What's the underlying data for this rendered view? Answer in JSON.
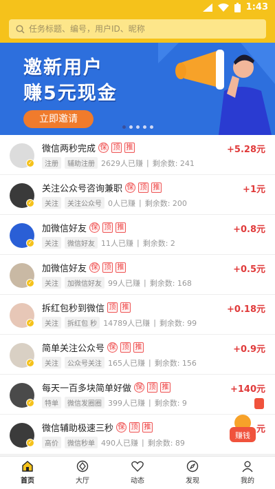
{
  "status_bar": {
    "time": "1:43"
  },
  "search": {
    "placeholder": "任务标题、编号，用户ID、昵称"
  },
  "banner": {
    "line1": "邀新用户",
    "line2": "赚5元现金",
    "button": "立即邀请"
  },
  "tasks": [
    {
      "title": "微信两秒完成",
      "tags": [
        "保",
        "顶",
        "推"
      ],
      "chips": [
        "注册",
        "辅助注册"
      ],
      "earned": "2629人已赚",
      "remaining": "剩余数: 241",
      "reward": "+5.28元"
    },
    {
      "title": "关注公众号咨询兼职",
      "tags": [
        "保",
        "顶",
        "推"
      ],
      "chips": [
        "关注",
        "关注公众号"
      ],
      "earned": "0人已赚",
      "remaining": "剩余数: 200",
      "reward": "+1元"
    },
    {
      "title": "加微信好友",
      "tags": [
        "保",
        "顶",
        "推"
      ],
      "chips": [
        "关注",
        "微信好友"
      ],
      "earned": "11人已赚",
      "remaining": "剩余数: 2",
      "reward": "+0.8元"
    },
    {
      "title": "加微信好友",
      "tags": [
        "保",
        "顶",
        "推"
      ],
      "chips": [
        "关注",
        "加微信好友"
      ],
      "earned": "99人已赚",
      "remaining": "剩余数: 168",
      "reward": "+0.5元"
    },
    {
      "title": "拆红包秒到微信",
      "tags": [
        "顶",
        "推"
      ],
      "chips": [
        "关注",
        "拆红包 秒"
      ],
      "earned": "14789人已赚",
      "remaining": "剩余数: 99",
      "reward": "+0.18元"
    },
    {
      "title": "简单关注公众号",
      "tags": [
        "保",
        "顶",
        "推"
      ],
      "chips": [
        "关注",
        "公众号关注"
      ],
      "earned": "165人已赚",
      "remaining": "剩余数: 156",
      "reward": "+0.9元"
    },
    {
      "title": "每天一百多块简单好做",
      "tags": [
        "保",
        "顶",
        "推"
      ],
      "chips": [
        "特单",
        "微信发圈圈"
      ],
      "earned": "399人已赚",
      "remaining": "剩余数: 9",
      "reward": "+140元"
    },
    {
      "title": "微信辅助极速三秒",
      "tags": [
        "保",
        "顶",
        "推"
      ],
      "chips": [
        "高价",
        "微信秒单"
      ],
      "earned": "490人已赚",
      "remaining": "剩余数: 89",
      "reward": "元"
    }
  ],
  "float_badge": "赚钱",
  "bottom_nav": [
    {
      "label": "首页",
      "icon": "home-icon"
    },
    {
      "label": "大厅",
      "icon": "hall-icon"
    },
    {
      "label": "动态",
      "icon": "heart-icon"
    },
    {
      "label": "发现",
      "icon": "compass-icon"
    },
    {
      "label": "我的",
      "icon": "user-icon"
    }
  ],
  "colors": {
    "accent": "#f5c21b",
    "reward": "#e03a3a",
    "banner": "#2d6fdd",
    "invite_button": "#f07b2c"
  }
}
